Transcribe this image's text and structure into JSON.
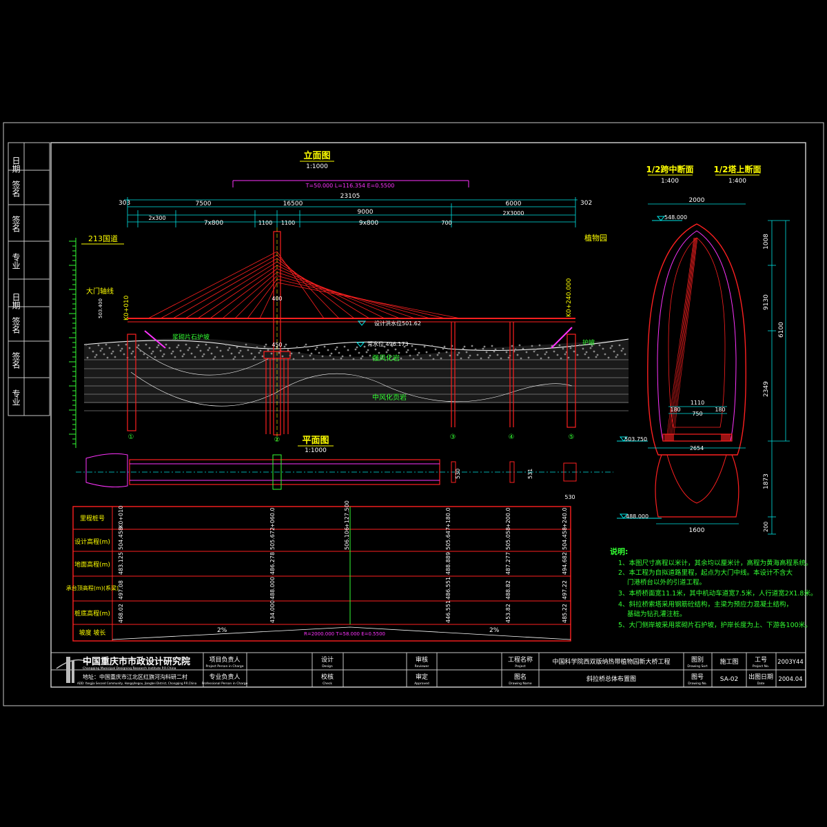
{
  "colors": {
    "background": "#000000",
    "frame": "#c8c8c8",
    "structure": "#ff2020",
    "dimension": "#00e5e5",
    "text_main": "#ffff00",
    "text_note": "#33ff33",
    "profile": "#ff33ff"
  },
  "side_strip": {
    "upper": [
      "日期",
      "签名",
      "签名",
      "专业"
    ],
    "lower": [
      "日期",
      "签名",
      "签名",
      "专业"
    ]
  },
  "elevation": {
    "title": "立面图",
    "scale": "1:1000",
    "top_dims": {
      "left": "303",
      "middle": "23105",
      "right": "302"
    },
    "mid_dims": [
      "7500",
      "16500",
      "9000",
      "6000"
    ],
    "lower_dims": [
      "2x300",
      "7x800",
      "1100",
      "1100",
      "9x800",
      "700",
      "2X3000"
    ],
    "curve_note": "T=50.000  L=116.354 E=0.5500",
    "road_left": "213国道",
    "road_right": "植物园",
    "gate_axis": "大门轴线",
    "tower_width_top": "400",
    "tower_width_bottom": "450",
    "design_water": "设计洪水位501.62",
    "normal_water": "常水位 496.173",
    "rock1": "强风化岩",
    "rock2": "中风化页岩",
    "slope_label": "护坡",
    "pier_labels": [
      "①",
      "②",
      "③",
      "④",
      "⑤"
    ],
    "station_left": "K0+010",
    "station_right": "K0+240.000",
    "elev_left": "503.400",
    "left_slope": "浆砌片石护坡"
  },
  "plan": {
    "title": "平面图",
    "scale": "1:1000",
    "dims": [
      "530",
      "531",
      "530"
    ]
  },
  "section": {
    "title_mid": "1/2跨中断面",
    "scale_mid": "1:400",
    "title_tower": "1/2塔上断面",
    "scale_tower": "1:400",
    "top_width": "2000",
    "top_elev": "548.000",
    "heights": [
      "1008",
      "9130",
      "6100",
      "2349",
      "1873",
      "200"
    ],
    "deck_width": "1110",
    "deck_parts": [
      "180",
      "750",
      "180"
    ],
    "deck_elev": "503.750",
    "base_width": "2654",
    "foot_width": "1600",
    "bottom_elev": "488.000"
  },
  "profile_table": {
    "rows": [
      "里程桩号",
      "设计高程(m)",
      "地面高程(m)",
      "承台顶高程(m)(系梁)",
      "桩底高程(m)",
      "坡度 坡长"
    ],
    "stations": [
      "K0+010",
      "+060.0",
      "+127.500",
      "+180.0",
      "+200.0",
      "+240.0"
    ],
    "design": [
      "504.458",
      "505.672",
      "506.106",
      "505.647",
      "505.058",
      "504.458"
    ],
    "ground": [
      "483.125",
      "486.278",
      "",
      "488.889",
      "487.277",
      "494.682"
    ],
    "cap": [
      "497.08",
      "488.000",
      "",
      "486.551",
      "488.82",
      "497.22"
    ],
    "pile": [
      "468.02",
      "434.000",
      "",
      "446.551",
      "453.82",
      "485.22"
    ],
    "grade_left": "2%",
    "grade_right": "2%",
    "curve": "R=2000.000  T=58.000 E=0.5500"
  },
  "notes": {
    "heading": "说明:",
    "items": [
      "1、本图尺寸高程以米计，其余均以厘米计，高程为黄海高程系统。",
      "2、本工程为自拟道路里程，起点为大门中线。本设计不含大",
      "门港桥台以外的引道工程。",
      "3、本桥桥面宽11.1米，其中机动车道宽7.5米，人行道宽2X1.8米。",
      "4、斜拉桥索塔采用钢筋砼结构，主梁为预应力混凝土结构，",
      "基础为钻孔灌注桩。",
      "5、大门侧岸坡采用浆砌片石护坡，护岸长度为上、下游各100米。"
    ]
  },
  "title_block": {
    "institute_cn": "中国重庆市市政设计研究院",
    "institute_en": "Chongqing Municipal Designing Research Institute P.R.China",
    "address_cn": "地址：中国重庆市江北区红旗河沟科研二村",
    "address_en": "ADD: Yangjia Second Community, Hongqihegou, Jiangbei District, Chongqing P.R.China",
    "labels": {
      "proj_lead": "项目负责人",
      "proj_lead_en": "Project Person in Charge",
      "prof_lead": "专业负责人",
      "prof_lead_en": "Professional Person in Charge",
      "design": "设计",
      "design_en": "Design",
      "check": "校核",
      "check_en": "Check",
      "review": "审核",
      "review_en": "Reviewer",
      "approve": "审定",
      "approve_en": "Approved",
      "project_name": "工程名称",
      "project_name_en": "Project",
      "drawing_name": "图名",
      "drawing_name_en": "Drawing Name",
      "stage": "图别",
      "stage_en": "Drawing Sort",
      "drawing_no": "图号",
      "drawing_no_en": "Drawing No.",
      "job_no": "工号",
      "job_no_en": "Project No.",
      "date": "出图日期",
      "date_en": "Date"
    },
    "project_value": "中国科学院西双版纳热带植物园新大桥工程",
    "drawing_value": "斜拉桥总体布置图",
    "stage_value": "施工图",
    "drawing_no_value": "SA-02",
    "job_no_value": "2003Y44",
    "date_value": "2004.04"
  }
}
